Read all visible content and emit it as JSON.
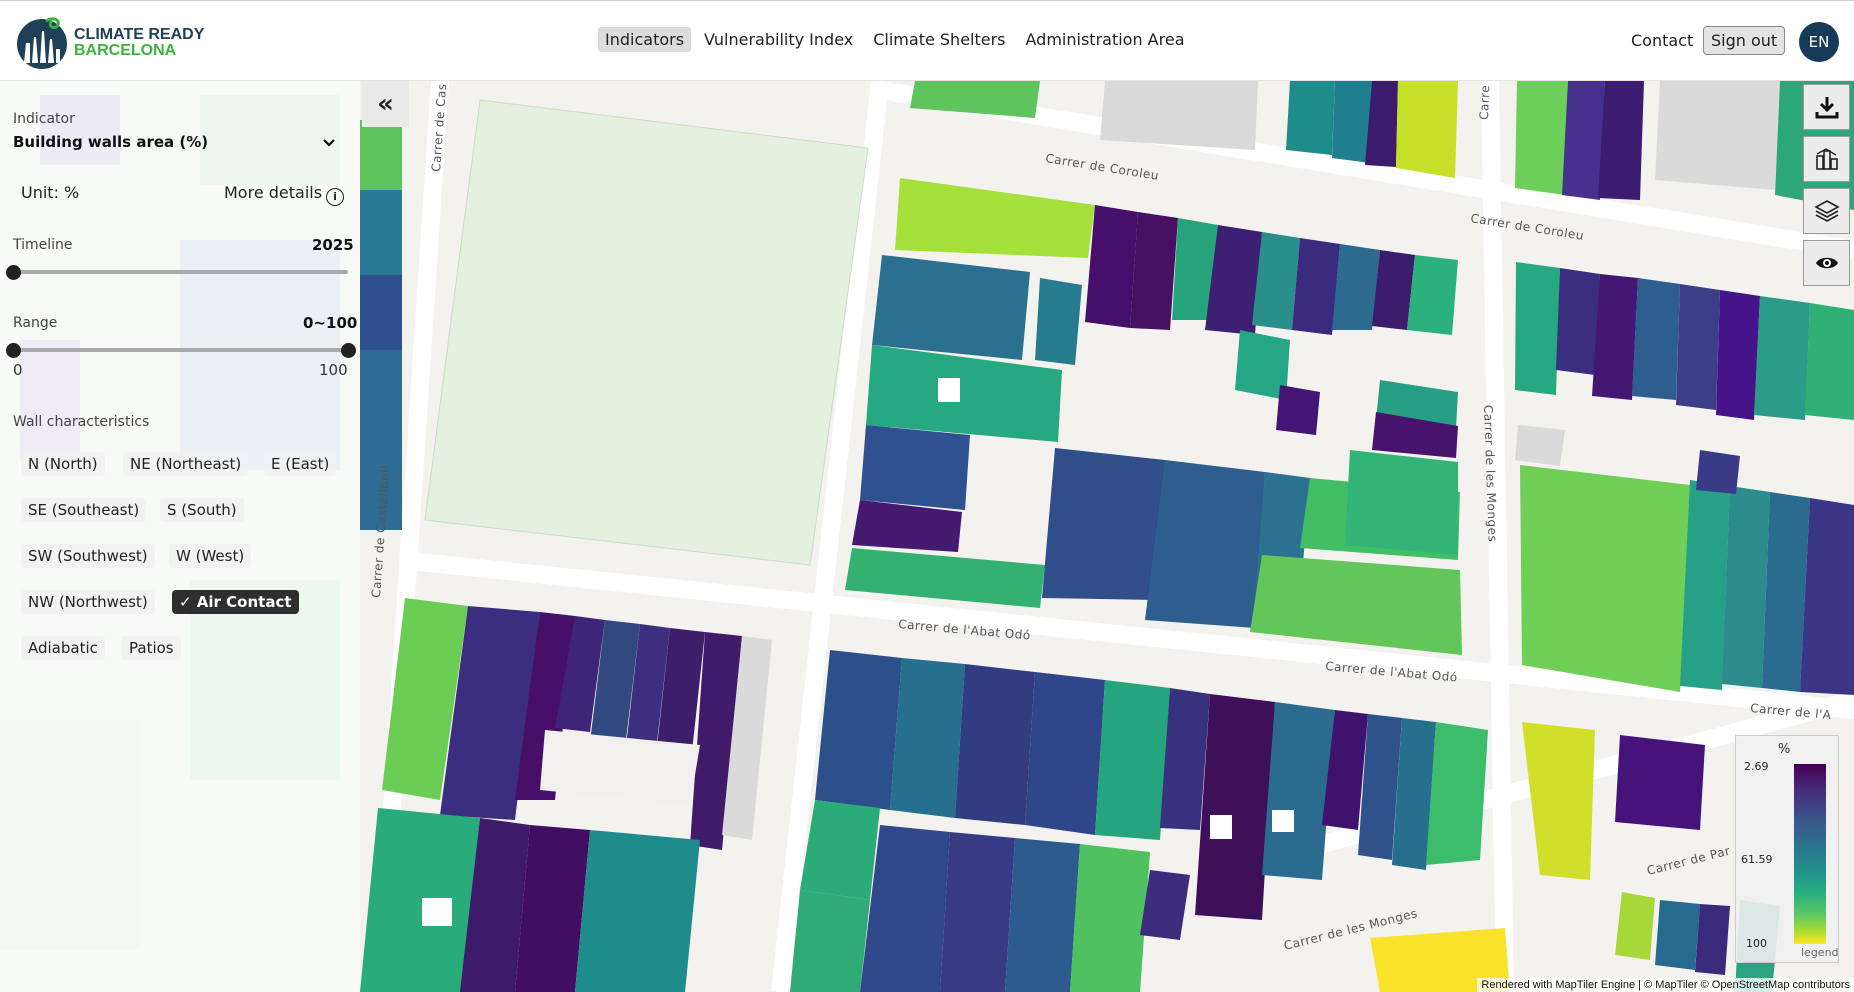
{
  "brand": {
    "line1": "CLIMATE READY",
    "line2": "BARCELONA"
  },
  "nav": [
    {
      "label": "Indicators",
      "active": true
    },
    {
      "label": "Vulnerability Index",
      "active": false
    },
    {
      "label": "Climate Shelters",
      "active": false
    },
    {
      "label": "Administration Area",
      "active": false
    }
  ],
  "header": {
    "contact": "Contact",
    "signout": "Sign out",
    "lang": "EN"
  },
  "panel": {
    "indicator_label": "Indicator",
    "indicator_value": "Building walls area (%)",
    "unit": "Unit: %",
    "more_details": "More details",
    "timeline_label": "Timeline",
    "timeline_value": "2025",
    "range_label": "Range",
    "range_value": "0~100",
    "range_min": "0",
    "range_max": "100",
    "wall_label": "Wall characteristics",
    "chips": [
      {
        "label": "N (North)",
        "selected": false
      },
      {
        "label": "NE (Northeast)",
        "selected": false
      },
      {
        "label": "E (East)",
        "selected": false
      },
      {
        "label": "SE (Southeast)",
        "selected": false
      },
      {
        "label": "S (South)",
        "selected": false
      },
      {
        "label": "SW (Southwest)",
        "selected": false
      },
      {
        "label": "W (West)",
        "selected": false
      },
      {
        "label": "NW (Northwest)",
        "selected": false
      },
      {
        "label": "✓ Air Contact",
        "selected": true
      },
      {
        "label": "Adiabatic",
        "selected": false
      },
      {
        "label": "Patios",
        "selected": false
      }
    ]
  },
  "legend": {
    "unit": "%",
    "top": "2.69",
    "mid": "61.59",
    "bottom": "100",
    "caption": "legend"
  },
  "streets": {
    "coroleu1": "Carrer de Coroleu",
    "coroleu2": "Carrer de Coroleu",
    "castellbell": "Carrer de Castellbell",
    "cas": "Carrer de Cas",
    "monges": "Carrer de les Monges",
    "abat1": "Carrer de l'Abat Odó",
    "abat2": "Carrer de l'Abat Odó",
    "abat3": "Carrer de l'A",
    "carrer_top": "Carre",
    "monges_bottom": "Carrer de les Monges",
    "par": "Carrer de Par"
  },
  "attribution": "Rendered with MapTiler Engine | © MapTiler © OpenStreetMap contributors",
  "icons": [
    "download-icon",
    "chart-icon",
    "layers-icon",
    "eye-icon",
    "collapse-icon",
    "info-icon",
    "chevron-down-icon"
  ]
}
